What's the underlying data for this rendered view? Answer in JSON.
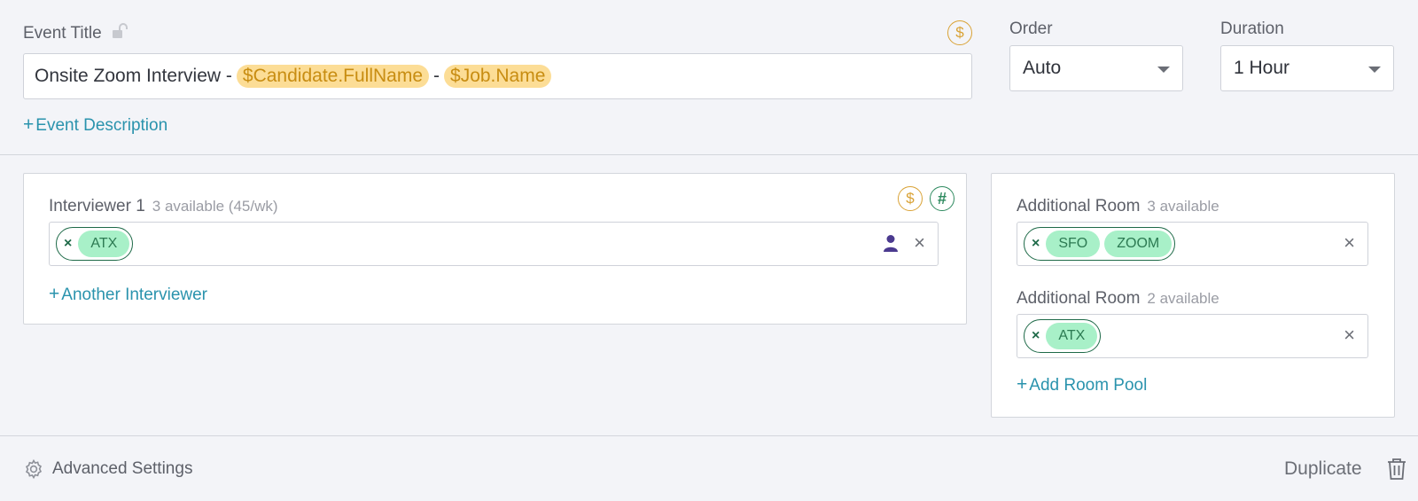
{
  "event": {
    "title_label": "Event Title",
    "title_prefix": "Onsite Zoom Interview -",
    "title_var1": "$Candidate.FullName",
    "title_sep": "-",
    "title_var2": "$Job.Name",
    "dollar_symbol": "$",
    "description_link": "Event Description",
    "plus": "+"
  },
  "order": {
    "label": "Order",
    "value": "Auto"
  },
  "duration": {
    "label": "Duration",
    "value": "1 Hour"
  },
  "interviewer": {
    "label": "Interviewer 1",
    "availability": "3 available (45/wk)",
    "dollar_symbol": "$",
    "hash_symbol": "#",
    "tags": [
      "ATX"
    ],
    "add_link": "Another Interviewer",
    "plus": "+"
  },
  "rooms": [
    {
      "label": "Additional Room",
      "availability": "3 available",
      "tags": [
        "SFO",
        "ZOOM"
      ]
    },
    {
      "label": "Additional Room",
      "availability": "2 available",
      "tags": [
        "ATX"
      ]
    }
  ],
  "add_room_pool": {
    "label": "Add Room Pool",
    "plus": "+"
  },
  "footer": {
    "advanced_settings": "Advanced Settings",
    "duplicate": "Duplicate"
  },
  "symbols": {
    "tag_remove": "×",
    "clear": "×"
  },
  "icons": {
    "lock": "lock-open-icon",
    "gear": "gear-icon",
    "trash": "trash-icon",
    "person": "person-icon"
  },
  "colors": {
    "accent_link": "#2a93ad",
    "variable_bg": "#fcdd96",
    "variable_text": "#c88d12",
    "tag_bg": "#a8f0c8",
    "tag_border": "#1e6a48",
    "person_icon": "#4b3a8f"
  }
}
